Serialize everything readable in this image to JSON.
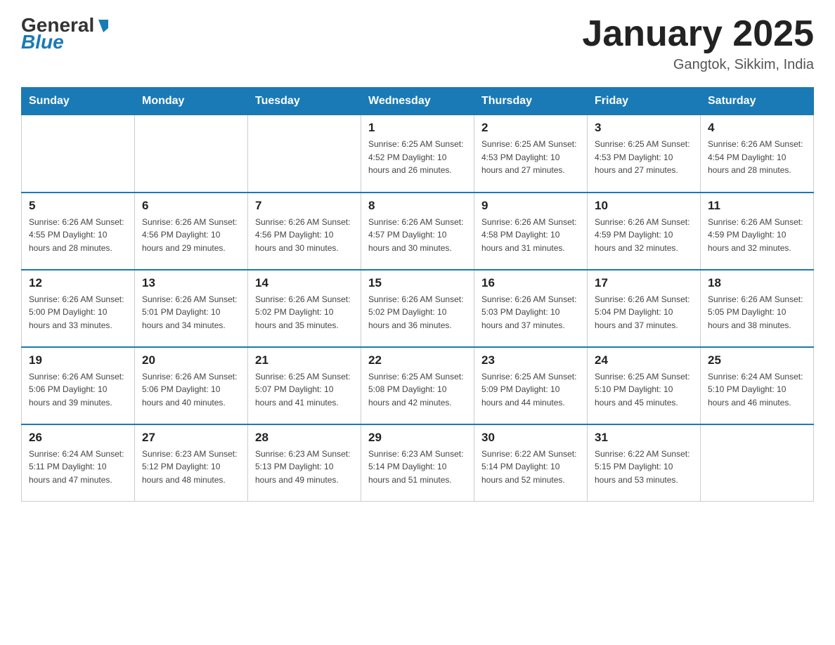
{
  "header": {
    "logo_text_black": "General",
    "logo_text_blue": "Blue",
    "month_title": "January 2025",
    "location": "Gangtok, Sikkim, India"
  },
  "weekdays": [
    "Sunday",
    "Monday",
    "Tuesday",
    "Wednesday",
    "Thursday",
    "Friday",
    "Saturday"
  ],
  "weeks": [
    [
      {
        "day": "",
        "info": ""
      },
      {
        "day": "",
        "info": ""
      },
      {
        "day": "",
        "info": ""
      },
      {
        "day": "1",
        "info": "Sunrise: 6:25 AM\nSunset: 4:52 PM\nDaylight: 10 hours\nand 26 minutes."
      },
      {
        "day": "2",
        "info": "Sunrise: 6:25 AM\nSunset: 4:53 PM\nDaylight: 10 hours\nand 27 minutes."
      },
      {
        "day": "3",
        "info": "Sunrise: 6:25 AM\nSunset: 4:53 PM\nDaylight: 10 hours\nand 27 minutes."
      },
      {
        "day": "4",
        "info": "Sunrise: 6:26 AM\nSunset: 4:54 PM\nDaylight: 10 hours\nand 28 minutes."
      }
    ],
    [
      {
        "day": "5",
        "info": "Sunrise: 6:26 AM\nSunset: 4:55 PM\nDaylight: 10 hours\nand 28 minutes."
      },
      {
        "day": "6",
        "info": "Sunrise: 6:26 AM\nSunset: 4:56 PM\nDaylight: 10 hours\nand 29 minutes."
      },
      {
        "day": "7",
        "info": "Sunrise: 6:26 AM\nSunset: 4:56 PM\nDaylight: 10 hours\nand 30 minutes."
      },
      {
        "day": "8",
        "info": "Sunrise: 6:26 AM\nSunset: 4:57 PM\nDaylight: 10 hours\nand 30 minutes."
      },
      {
        "day": "9",
        "info": "Sunrise: 6:26 AM\nSunset: 4:58 PM\nDaylight: 10 hours\nand 31 minutes."
      },
      {
        "day": "10",
        "info": "Sunrise: 6:26 AM\nSunset: 4:59 PM\nDaylight: 10 hours\nand 32 minutes."
      },
      {
        "day": "11",
        "info": "Sunrise: 6:26 AM\nSunset: 4:59 PM\nDaylight: 10 hours\nand 32 minutes."
      }
    ],
    [
      {
        "day": "12",
        "info": "Sunrise: 6:26 AM\nSunset: 5:00 PM\nDaylight: 10 hours\nand 33 minutes."
      },
      {
        "day": "13",
        "info": "Sunrise: 6:26 AM\nSunset: 5:01 PM\nDaylight: 10 hours\nand 34 minutes."
      },
      {
        "day": "14",
        "info": "Sunrise: 6:26 AM\nSunset: 5:02 PM\nDaylight: 10 hours\nand 35 minutes."
      },
      {
        "day": "15",
        "info": "Sunrise: 6:26 AM\nSunset: 5:02 PM\nDaylight: 10 hours\nand 36 minutes."
      },
      {
        "day": "16",
        "info": "Sunrise: 6:26 AM\nSunset: 5:03 PM\nDaylight: 10 hours\nand 37 minutes."
      },
      {
        "day": "17",
        "info": "Sunrise: 6:26 AM\nSunset: 5:04 PM\nDaylight: 10 hours\nand 37 minutes."
      },
      {
        "day": "18",
        "info": "Sunrise: 6:26 AM\nSunset: 5:05 PM\nDaylight: 10 hours\nand 38 minutes."
      }
    ],
    [
      {
        "day": "19",
        "info": "Sunrise: 6:26 AM\nSunset: 5:06 PM\nDaylight: 10 hours\nand 39 minutes."
      },
      {
        "day": "20",
        "info": "Sunrise: 6:26 AM\nSunset: 5:06 PM\nDaylight: 10 hours\nand 40 minutes."
      },
      {
        "day": "21",
        "info": "Sunrise: 6:25 AM\nSunset: 5:07 PM\nDaylight: 10 hours\nand 41 minutes."
      },
      {
        "day": "22",
        "info": "Sunrise: 6:25 AM\nSunset: 5:08 PM\nDaylight: 10 hours\nand 42 minutes."
      },
      {
        "day": "23",
        "info": "Sunrise: 6:25 AM\nSunset: 5:09 PM\nDaylight: 10 hours\nand 44 minutes."
      },
      {
        "day": "24",
        "info": "Sunrise: 6:25 AM\nSunset: 5:10 PM\nDaylight: 10 hours\nand 45 minutes."
      },
      {
        "day": "25",
        "info": "Sunrise: 6:24 AM\nSunset: 5:10 PM\nDaylight: 10 hours\nand 46 minutes."
      }
    ],
    [
      {
        "day": "26",
        "info": "Sunrise: 6:24 AM\nSunset: 5:11 PM\nDaylight: 10 hours\nand 47 minutes."
      },
      {
        "day": "27",
        "info": "Sunrise: 6:23 AM\nSunset: 5:12 PM\nDaylight: 10 hours\nand 48 minutes."
      },
      {
        "day": "28",
        "info": "Sunrise: 6:23 AM\nSunset: 5:13 PM\nDaylight: 10 hours\nand 49 minutes."
      },
      {
        "day": "29",
        "info": "Sunrise: 6:23 AM\nSunset: 5:14 PM\nDaylight: 10 hours\nand 51 minutes."
      },
      {
        "day": "30",
        "info": "Sunrise: 6:22 AM\nSunset: 5:14 PM\nDaylight: 10 hours\nand 52 minutes."
      },
      {
        "day": "31",
        "info": "Sunrise: 6:22 AM\nSunset: 5:15 PM\nDaylight: 10 hours\nand 53 minutes."
      },
      {
        "day": "",
        "info": ""
      }
    ]
  ]
}
